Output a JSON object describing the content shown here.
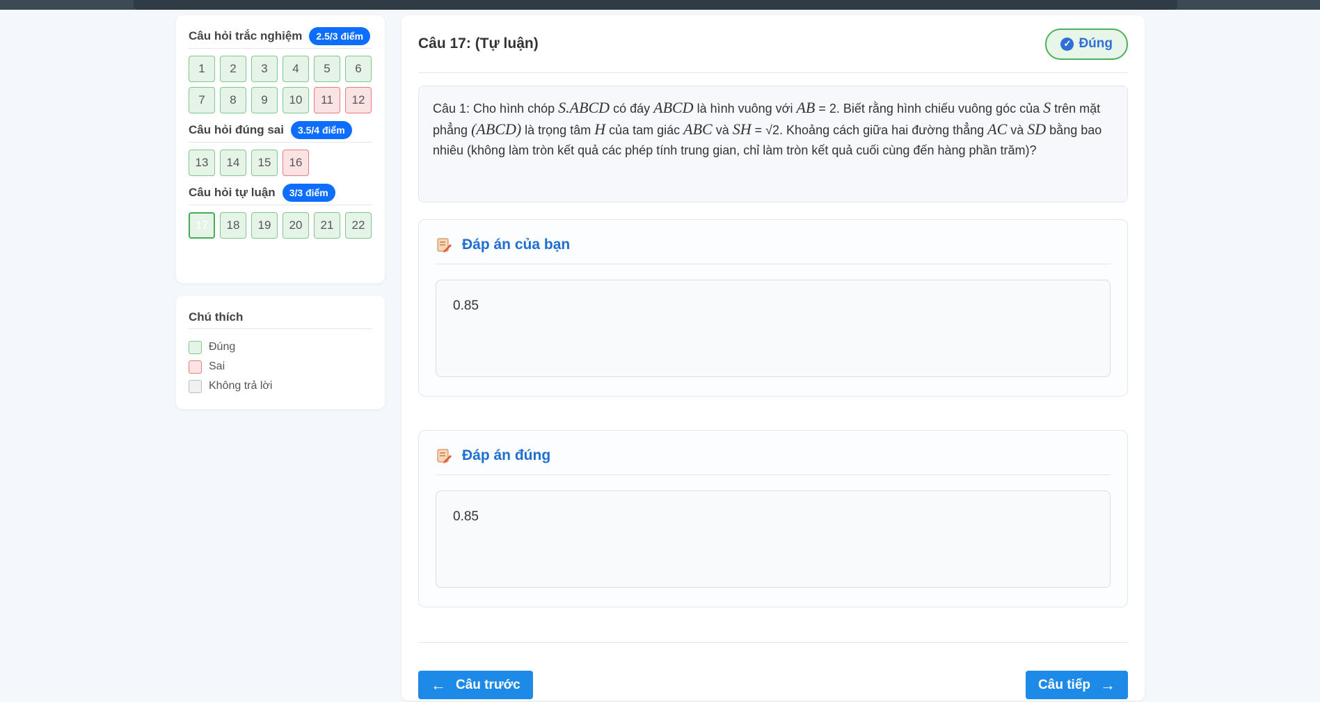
{
  "sidebar": {
    "sections": [
      {
        "title": "Câu hỏi trắc nghiệm",
        "score": "2.5/3 điểm",
        "questions": [
          {
            "n": "1",
            "state": "correct"
          },
          {
            "n": "2",
            "state": "correct"
          },
          {
            "n": "3",
            "state": "correct"
          },
          {
            "n": "4",
            "state": "correct"
          },
          {
            "n": "5",
            "state": "correct"
          },
          {
            "n": "6",
            "state": "correct"
          },
          {
            "n": "7",
            "state": "correct"
          },
          {
            "n": "8",
            "state": "correct"
          },
          {
            "n": "9",
            "state": "correct"
          },
          {
            "n": "10",
            "state": "correct"
          },
          {
            "n": "11",
            "state": "wrong"
          },
          {
            "n": "12",
            "state": "wrong"
          }
        ]
      },
      {
        "title": "Câu hỏi đúng sai",
        "score": "3.5/4 điểm",
        "questions": [
          {
            "n": "13",
            "state": "correct"
          },
          {
            "n": "14",
            "state": "correct"
          },
          {
            "n": "15",
            "state": "correct"
          },
          {
            "n": "16",
            "state": "wrong"
          }
        ]
      },
      {
        "title": "Câu hỏi tự luận",
        "score": "3/3 điểm",
        "questions": [
          {
            "n": "17",
            "state": "active"
          },
          {
            "n": "18",
            "state": "correct"
          },
          {
            "n": "19",
            "state": "correct"
          },
          {
            "n": "20",
            "state": "correct"
          },
          {
            "n": "21",
            "state": "correct"
          },
          {
            "n": "22",
            "state": "correct"
          }
        ]
      }
    ]
  },
  "legend": {
    "title": "Chú thích",
    "items": [
      {
        "label": "Đúng",
        "kind": "correct"
      },
      {
        "label": "Sai",
        "kind": "wrong"
      },
      {
        "label": "Không trả lời",
        "kind": "none"
      }
    ]
  },
  "question": {
    "header": "Câu 17: (Tự luận)",
    "status": "Đúng",
    "text": {
      "p1": "Câu 1: Cho hình chóp ",
      "m1": "S.ABCD",
      "p2": " có đáy ",
      "m2": "ABCD",
      "p3": " là hình vuông với ",
      "m3": "AB",
      "p4": " = 2. Biết rằng hình chiếu vuông góc của ",
      "m4": "S",
      "p5": " trên mặt phẳng ",
      "m5": "(ABCD)",
      "p6": " là trọng tâm ",
      "m6": "H",
      "p7": " của tam giác ",
      "m7": "ABC",
      "p8": " và ",
      "m8": "SH",
      "p9": " = √2. Khoảng cách giữa hai đường thẳng ",
      "m9": "AC",
      "p10": " và ",
      "m10": "SD",
      "p11": " bằng bao nhiêu (không làm tròn kết quả các phép tính trung gian, chỉ làm tròn kết quả cuối cùng đến hàng phần trăm)?"
    }
  },
  "your_answer": {
    "title": "Đáp án của bạn",
    "value": "0.85"
  },
  "correct_answer": {
    "title": "Đáp án đúng",
    "value": "0.85"
  },
  "nav": {
    "prev": "Câu trước",
    "next": "Câu tiếp"
  },
  "colors": {
    "correct": "#e6f4e8",
    "wrong": "#fbe3e3",
    "accent": "#1e8ae8",
    "badge": "#0d6efd"
  }
}
